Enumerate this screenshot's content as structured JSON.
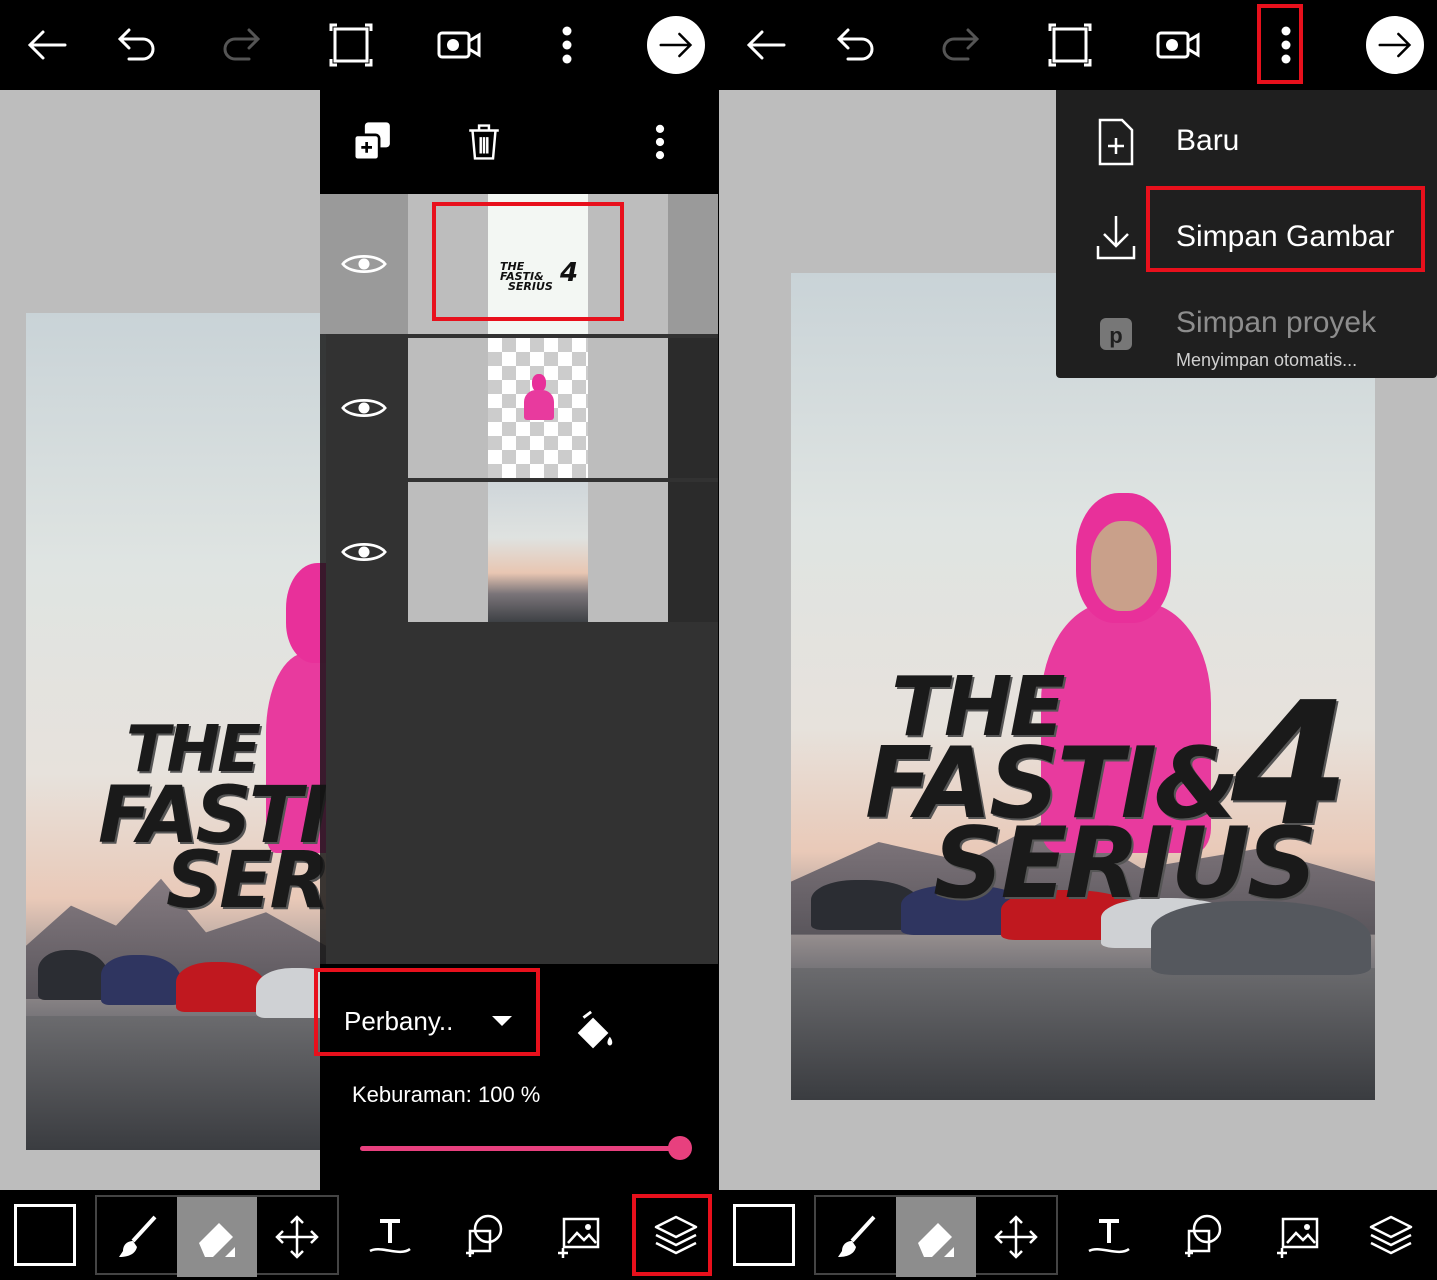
{
  "left_panel": {
    "toolbar": {
      "back_icon": "arrow-left-icon",
      "undo_icon": "undo-icon",
      "redo_icon": "redo-icon",
      "crop_icon": "crop-icon",
      "record_icon": "video-camera-icon",
      "more_icon": "more-vertical-icon",
      "next_icon": "arrow-right-circle-icon"
    },
    "layers_panel": {
      "add_layer_icon": "add-layer-icon",
      "delete_icon": "trash-icon",
      "more_icon": "more-vertical-icon",
      "layers": [
        {
          "type": "text",
          "thumb_line1": "THE",
          "thumb_line2": "FASTI&",
          "thumb_line3": "SERIUS",
          "thumb_num": "4",
          "visible_icon": "eye-icon"
        },
        {
          "type": "cutout",
          "visible_icon": "eye-icon"
        },
        {
          "type": "background",
          "visible_icon": "eye-icon"
        }
      ],
      "blend_mode": "Perbany..",
      "fill_icon": "paint-bucket-icon",
      "opacity_label": "Keburaman:",
      "opacity_value": "100 %",
      "opacity_level": 1.0
    }
  },
  "right_panel": {
    "menu": {
      "items": [
        {
          "label": "Baru",
          "icon": "new-file-icon",
          "enabled": true
        },
        {
          "label": "Simpan Gambar",
          "icon": "download-icon",
          "enabled": true
        },
        {
          "label": "Simpan proyek",
          "subtitle": "Menyimpan otomatis...",
          "icon": "picsart-project-icon",
          "enabled": false
        }
      ]
    }
  },
  "poster": {
    "line1": "THE",
    "line2": "FASTI&",
    "line3": "SERIUS",
    "number": "4"
  },
  "bottom_tools": [
    "color-swatch",
    "brush-icon",
    "eraser-icon",
    "move-icon",
    "text-icon",
    "shape-icon",
    "add-photo-icon",
    "layers-icon"
  ],
  "colors": {
    "highlight": "#e8101c",
    "slider_accent": "#e8407e",
    "toolbar_bg": "#000000",
    "canvas_bg": "#bdbdbd"
  }
}
